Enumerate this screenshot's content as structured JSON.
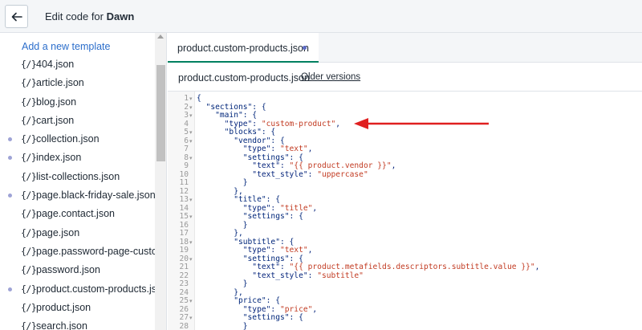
{
  "header": {
    "title_prefix": "Edit code for ",
    "title_theme": "Dawn"
  },
  "sidebar": {
    "add_template_label": "Add a new template",
    "files": [
      {
        "name": "404.json",
        "dot": false
      },
      {
        "name": "article.json",
        "dot": false
      },
      {
        "name": "blog.json",
        "dot": false
      },
      {
        "name": "cart.json",
        "dot": false
      },
      {
        "name": "collection.json",
        "dot": true
      },
      {
        "name": "index.json",
        "dot": true
      },
      {
        "name": "list-collections.json",
        "dot": false
      },
      {
        "name": "page.black-friday-sale.json",
        "dot": true
      },
      {
        "name": "page.contact.json",
        "dot": false
      },
      {
        "name": "page.json",
        "dot": false
      },
      {
        "name": "page.password-page-custom",
        "dot": false
      },
      {
        "name": "password.json",
        "dot": false
      },
      {
        "name": "product.custom-products.json",
        "dot": true
      },
      {
        "name": "product.json",
        "dot": false
      },
      {
        "name": "search.json",
        "dot": false
      }
    ],
    "file_icon": "{/}"
  },
  "editor": {
    "tab_label": "product.custom-products.json",
    "file_title": "product.custom-products.json",
    "older_versions_label": "Older versions",
    "lines": [
      {
        "n": "1",
        "fold": true,
        "text": "{"
      },
      {
        "n": "2",
        "fold": true,
        "text": "  \"sections\": {"
      },
      {
        "n": "3",
        "fold": true,
        "text": "    \"main\": {"
      },
      {
        "n": "4",
        "fold": false,
        "key": "      \"type\": ",
        "str": "\"custom-product\"",
        "tail": ","
      },
      {
        "n": "5",
        "fold": true,
        "text": "      \"blocks\": {"
      },
      {
        "n": "6",
        "fold": true,
        "text": "        \"vendor\": {"
      },
      {
        "n": "7",
        "fold": false,
        "key": "          \"type\": ",
        "str": "\"text\"",
        "tail": ","
      },
      {
        "n": "8",
        "fold": true,
        "text": "          \"settings\": {"
      },
      {
        "n": "9",
        "fold": false,
        "key": "            \"text\": ",
        "str": "\"{{ product.vendor }}\"",
        "tail": ","
      },
      {
        "n": "10",
        "fold": false,
        "key": "            \"text_style\": ",
        "str": "\"uppercase\"",
        "tail": ""
      },
      {
        "n": "11",
        "fold": false,
        "text": "          }"
      },
      {
        "n": "12",
        "fold": false,
        "text": "        },"
      },
      {
        "n": "13",
        "fold": true,
        "text": "        \"title\": {"
      },
      {
        "n": "14",
        "fold": false,
        "key": "          \"type\": ",
        "str": "\"title\"",
        "tail": ","
      },
      {
        "n": "15",
        "fold": true,
        "text": "          \"settings\": {"
      },
      {
        "n": "16",
        "fold": false,
        "text": "          }"
      },
      {
        "n": "17",
        "fold": false,
        "text": "        },"
      },
      {
        "n": "18",
        "fold": true,
        "text": "        \"subtitle\": {"
      },
      {
        "n": "19",
        "fold": false,
        "key": "          \"type\": ",
        "str": "\"text\"",
        "tail": ","
      },
      {
        "n": "20",
        "fold": true,
        "text": "          \"settings\": {"
      },
      {
        "n": "21",
        "fold": false,
        "key": "            \"text\": ",
        "str": "\"{{ product.metafields.descriptors.subtitle.value }}\"",
        "tail": ","
      },
      {
        "n": "22",
        "fold": false,
        "key": "            \"text_style\": ",
        "str": "\"subtitle\"",
        "tail": ""
      },
      {
        "n": "23",
        "fold": false,
        "text": "          }"
      },
      {
        "n": "24",
        "fold": false,
        "text": "        },"
      },
      {
        "n": "25",
        "fold": true,
        "text": "        \"price\": {"
      },
      {
        "n": "26",
        "fold": false,
        "key": "          \"type\": ",
        "str": "\"price\"",
        "tail": ","
      },
      {
        "n": "27",
        "fold": true,
        "text": "          \"settings\": {"
      },
      {
        "n": "28",
        "fold": false,
        "text": "          }"
      }
    ]
  },
  "colors": {
    "accent": "#008060",
    "link": "#2c6ecb",
    "string": "#c23b22",
    "arrow": "#e02020"
  }
}
